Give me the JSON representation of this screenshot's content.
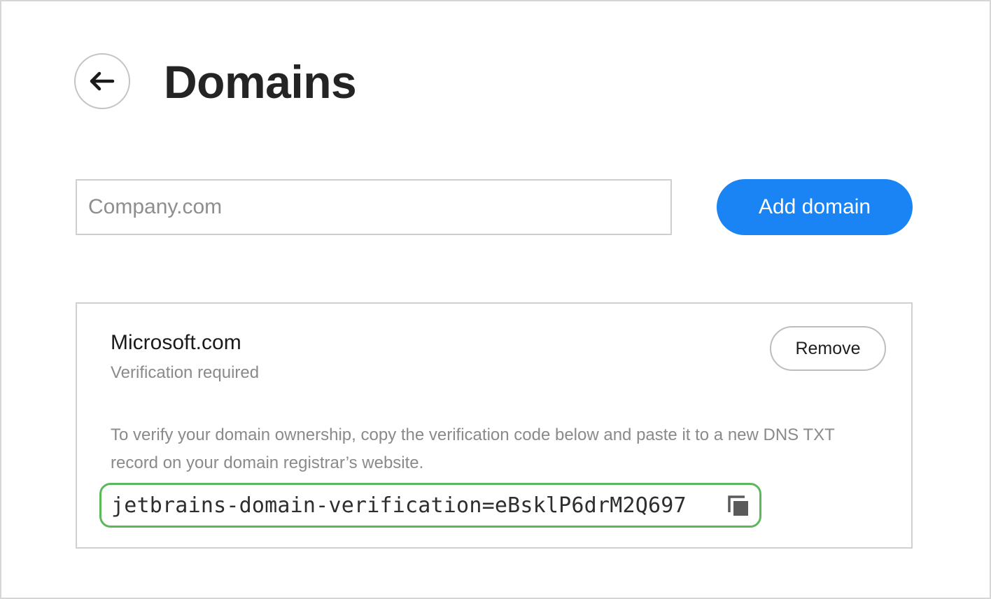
{
  "header": {
    "title": "Domains",
    "back_icon": "arrow-left-icon"
  },
  "add_domain": {
    "placeholder": "Company.com",
    "value": "",
    "button_label": "Add domain",
    "accent_color": "#1a84f5"
  },
  "domain_entry": {
    "name": "Microsoft.com",
    "status": "Verification required",
    "remove_label": "Remove",
    "instructions": "To verify your domain ownership, copy the verification code below and paste it to a new DNS TXT record on your domain registrar’s website.",
    "verification_code": "jetbrains-domain-verification=eBsklP6drM2Q697",
    "copy_icon": "copy-icon",
    "highlight_color": "#5cb85c"
  }
}
